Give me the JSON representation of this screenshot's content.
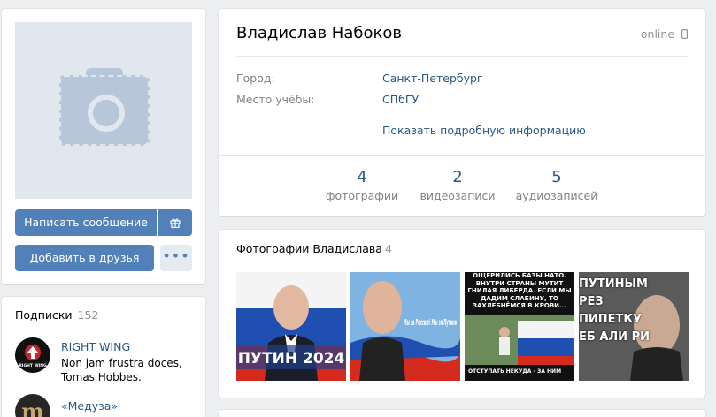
{
  "profile": {
    "name": "Владислав Набоков",
    "status": "online",
    "city_label": "Город:",
    "city_value": "Санкт-Петербург",
    "study_label": "Место учёбы:",
    "study_value": "СПбГУ",
    "more_info": "Показать подробную информацию"
  },
  "counters": [
    {
      "num": "4",
      "label": "фотографии"
    },
    {
      "num": "2",
      "label": "видеозаписи"
    },
    {
      "num": "5",
      "label": "аудиозаписей"
    }
  ],
  "actions": {
    "message": "Написать сообщение",
    "add_friend": "Добавить в друзья",
    "more": "•••"
  },
  "subscriptions": {
    "title": "Подписки",
    "count": "152",
    "items": [
      {
        "name": "RIGHT WING",
        "desc": "Non jam frustra doces, Tomas Hobbes.",
        "avatar_text": "RIGHT WING"
      },
      {
        "name": "«Медуза»",
        "desc": "",
        "avatar_text": "m"
      }
    ]
  },
  "photos": {
    "title": "Фотографии Владислава",
    "count": "4",
    "thumbs": [
      {
        "caption": "ПУТИН 2024"
      },
      {
        "caption": "Мы за Россию! Мы за Путина"
      },
      {
        "caption": "ОЩЕРИЛИСЬ БАЗЫ НАТО. ВНУТРИ СТРАНЫ МУТИТ ГНИЛАЯ ЛИБЕРДА. ЕСЛИ МЫ ДАДИМ СЛАБИНУ, ТО ЗАХЛЕБНЁМСЯ В КРОВИ...",
        "caption2": "ОТСТУПАТЬ НЕКУДА - ЗА НИМ"
      },
      {
        "caption": "ПУТИНЫМ РЕЗ ПИПЕТКУ ЕБ АЛИ РИ"
      }
    ]
  },
  "colors": {
    "accent": "#5181b8",
    "link": "#2a5885",
    "background": "#edeef0"
  }
}
